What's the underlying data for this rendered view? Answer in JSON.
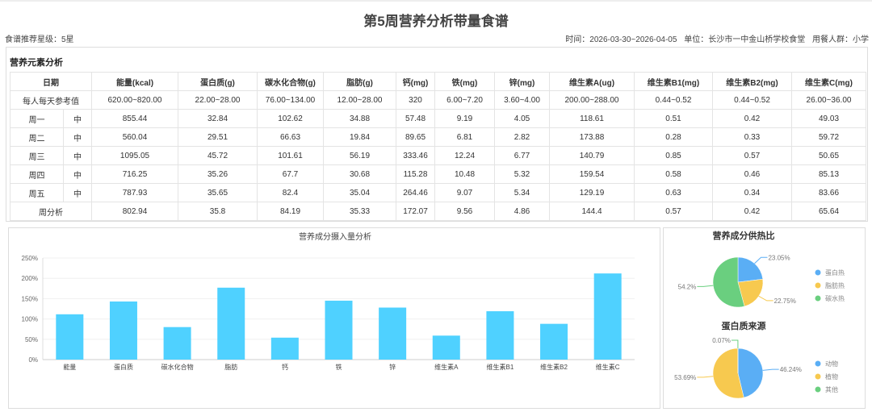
{
  "header": {
    "title": "第5周营养分析带量食谱",
    "rating": "食谱推荐星级：5星",
    "time": "时间：2026-03-30~2026-04-05",
    "unit": "单位：长沙市一中金山桥学校食堂",
    "group": "用餐人群：小学"
  },
  "table": {
    "section_title": "营养元素分析",
    "headers": [
      "日期",
      "能量(kcal)",
      "蛋白质(g)",
      "碳水化合物(g)",
      "脂肪(g)",
      "钙(mg)",
      "铁(mg)",
      "锌(mg)",
      "维生素A(ug)",
      "维生素B1(mg)",
      "维生素B2(mg)",
      "维生素C(mg)"
    ],
    "reference": {
      "label": "每人每天参考值",
      "values": [
        "620.00~820.00",
        "22.00~28.00",
        "76.00~134.00",
        "12.00~28.00",
        "320",
        "6.00~7.20",
        "3.60~4.00",
        "200.00~288.00",
        "0.44~0.52",
        "0.44~0.52",
        "26.00~36.00"
      ]
    },
    "rows": [
      {
        "day": "周一",
        "meal": "中",
        "values": [
          "855.44",
          "32.84",
          "102.62",
          "34.88",
          "57.48",
          "9.19",
          "4.05",
          "118.61",
          "0.51",
          "0.42",
          "49.03"
        ]
      },
      {
        "day": "周二",
        "meal": "中",
        "values": [
          "560.04",
          "29.51",
          "66.63",
          "19.84",
          "89.65",
          "6.81",
          "2.82",
          "173.88",
          "0.28",
          "0.33",
          "59.72"
        ]
      },
      {
        "day": "周三",
        "meal": "中",
        "values": [
          "1095.05",
          "45.72",
          "101.61",
          "56.19",
          "333.46",
          "12.24",
          "6.77",
          "140.79",
          "0.85",
          "0.57",
          "50.65"
        ]
      },
      {
        "day": "周四",
        "meal": "中",
        "values": [
          "716.25",
          "35.26",
          "67.7",
          "30.68",
          "115.28",
          "10.48",
          "5.32",
          "159.54",
          "0.58",
          "0.46",
          "85.13"
        ]
      },
      {
        "day": "周五",
        "meal": "中",
        "values": [
          "787.93",
          "35.65",
          "82.4",
          "35.04",
          "264.46",
          "9.07",
          "5.34",
          "129.19",
          "0.63",
          "0.34",
          "83.66"
        ]
      }
    ],
    "summary": {
      "label": "周分析",
      "values": [
        "802.94",
        "35.8",
        "84.19",
        "35.33",
        "172.07",
        "9.56",
        "4.86",
        "144.4",
        "0.57",
        "0.42",
        "65.64"
      ]
    }
  },
  "chart_data": [
    {
      "type": "bar",
      "title": "营养成分摄入量分析",
      "categories": [
        "能量",
        "蛋白质",
        "碳水化合物",
        "脂肪",
        "钙",
        "铁",
        "锌",
        "维生素A",
        "维生素B1",
        "维生素B2",
        "维生素C"
      ],
      "values": [
        111.5,
        143,
        80,
        177,
        54,
        145,
        128,
        59,
        119,
        88,
        212
      ],
      "ylim": [
        0,
        250
      ],
      "yticks": [
        "0%",
        "50%",
        "100%",
        "150%",
        "200%",
        "250%"
      ],
      "color": "#4fd1ff",
      "grid": true
    },
    {
      "type": "pie",
      "title": "营养成分供热比",
      "slices": [
        {
          "label": "蛋白热",
          "value": 23.05,
          "text": "23.05%",
          "color": "#5aaef5"
        },
        {
          "label": "脂肪热",
          "value": 22.75,
          "text": "22.75%",
          "color": "#f7c94f"
        },
        {
          "label": "碳水热",
          "value": 54.2,
          "text": "54.2%",
          "color": "#6acf7f"
        }
      ]
    },
    {
      "type": "pie",
      "title": "蛋白质来源",
      "slices": [
        {
          "label": "动物",
          "value": 46.24,
          "text": "46.24%",
          "color": "#5aaef5"
        },
        {
          "label": "植物",
          "value": 53.69,
          "text": "53.69%",
          "color": "#f7c94f"
        },
        {
          "label": "其他",
          "value": 0.07,
          "text": "0.07%",
          "color": "#6acf7f"
        }
      ]
    }
  ]
}
